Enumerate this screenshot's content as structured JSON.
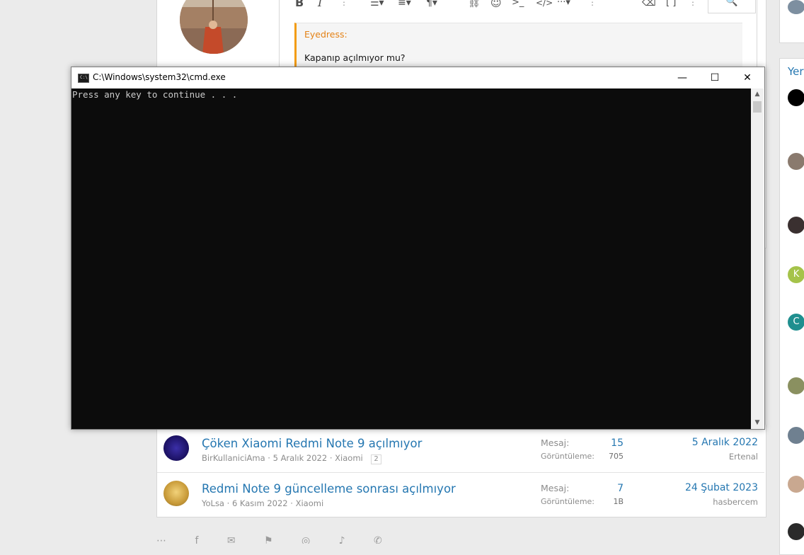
{
  "colors": {
    "link": "#2577b1",
    "quote_accent": "#f39c12",
    "quote_author": "#e48216",
    "console_bg": "#0c0c0c",
    "console_text": "#cccccc"
  },
  "editor": {
    "toolbar_icons": [
      "bold-icon",
      "italic-icon",
      "more-icon",
      "list-icon",
      "align-icon",
      "paragraph-icon",
      "link-icon",
      "emoji-icon",
      "terminal-icon",
      "code-icon",
      "ellipsis-icon",
      "more-icon",
      "eraser-icon",
      "brackets-icon",
      "more-icon",
      "preview-icon"
    ],
    "quote_author": "Eyedress:",
    "quote_text": "Kapanıp açılmıyor mu?"
  },
  "sidebar": {
    "label": "Yer",
    "avatar_letters": [
      "K",
      "C"
    ]
  },
  "threads": [
    {
      "title": "Çöken Xiaomi Redmi Note 9 açılmıyor",
      "author": "BirKullaniciAma",
      "date": "5 Aralık 2022",
      "forum": "Xiaomi",
      "page": "2",
      "replies_label": "Mesaj:",
      "replies": "15",
      "views_label": "Görüntüleme:",
      "views": "705",
      "last_date": "5 Aralık 2022",
      "last_user": "Ertenal"
    },
    {
      "title": "Redmi Note 9 güncelleme sonrası açılmıyor",
      "author": "YoLsa",
      "date": "6 Kasım 2022",
      "forum": "Xiaomi",
      "replies_label": "Mesaj:",
      "replies": "7",
      "views_label": "Görüntüleme:",
      "views": "1B",
      "last_date": "24 Şubat 2023",
      "last_user": "hasbercem"
    }
  ],
  "cmd": {
    "title": "C:\\Windows\\system32\\cmd.exe",
    "icon_text": "C:\\",
    "output": "Press any key to continue . . .",
    "buttons": {
      "minimize": "—",
      "maximize": "☐",
      "close": "✕"
    }
  }
}
